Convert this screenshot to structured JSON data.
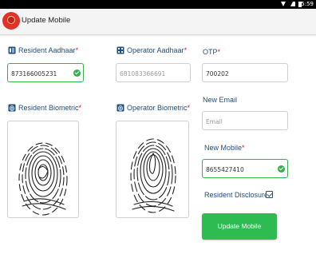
{
  "statusbar": {
    "time": "15:59"
  },
  "appbar": {
    "title": "Update Mobile"
  },
  "resident_aadhaar": {
    "label": "Resident Aadhaar",
    "required": "*",
    "value": "873166005231"
  },
  "operator_aadhaar": {
    "label": "Operator Aadhaar",
    "required": "*",
    "placeholder": "681083366691"
  },
  "otp": {
    "label": "OTP",
    "required": "*",
    "value": "700202"
  },
  "resident_biometric": {
    "label": "Resident Biometric",
    "required": "*"
  },
  "operator_biometric": {
    "label": "Operator Biometric",
    "required": "*"
  },
  "new_email": {
    "label": "New Email",
    "placeholder": "Email"
  },
  "new_mobile": {
    "label": "New Mobile",
    "required": "*",
    "value": "8655427410"
  },
  "disclosure": {
    "label": "Resident Disclosure",
    "required": "*",
    "checked": true
  },
  "submit": {
    "label": "Update Mobile"
  },
  "colors": {
    "label": "#1f4f86",
    "required": "#d8202a",
    "accent": "#2dbb52"
  },
  "icons": [
    "aadhaar-card-icon",
    "fingerprint-icon",
    "checkmark-icon",
    "checkbox-icon"
  ]
}
